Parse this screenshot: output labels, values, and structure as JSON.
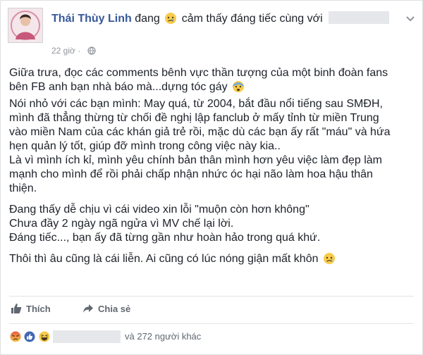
{
  "post": {
    "author": "Thái Thùy Linh",
    "status_prefix": "đang",
    "feeling": "cảm thấy đáng tiếc cùng với",
    "timestamp": "22 giờ",
    "paragraphs": [
      [
        "Giữa trưa, đọc các comments bênh vực thần tượng của một binh đoàn fans",
        "bên FB anh bạn nhà báo mà...dựng tóc gáy",
        "Nói nhỏ với các bạn mình: May quá, từ 2004, bắt đầu nổi tiếng sau SMĐH,",
        "mình đã thẳng thừng từ chối đề nghị lập fanclub ở mấy tỉnh từ miền Trung",
        "vào miền Nam của các khán giả trẻ rồi, mặc dù các bạn ấy rất \"máu\" và hứa",
        "hẹn quản lý tốt, giúp đỡ mình trong công việc này kia..",
        "Là vì mình ích kỉ, mình yêu chính bản thân mình hơn yêu việc làm đẹp làm",
        "mạnh cho mình để rồi phải chấp nhận nhức óc hại não làm hoa hậu thân",
        "thiện."
      ],
      [
        "Đang thấy dễ chịu vì cái video xin lỗi \"muộn còn hơn không\"",
        "Chưa đầy 2 ngày ngã ngửa vì MV chế lại lời.",
        "Đáng tiếc..., bạn ấy đã từng gần như hoàn hảo trong quá khứ."
      ],
      [
        "Thôi thì âu cũng là cái liễn. Ai cũng có lúc nóng giận mất khôn"
      ]
    ]
  },
  "actions": {
    "like_label": "Thích",
    "share_label": "Chia sẻ"
  },
  "reactions": {
    "icons": [
      "angry-icon",
      "like-icon",
      "haha-icon"
    ],
    "count_text": "và 272 người khác"
  },
  "icons": {
    "feeling": "sad-face-icon",
    "inline_1": "scared-face-icon",
    "inline_2": "sad-face-icon",
    "privacy": "globe-icon",
    "menu": "chevron-down-icon"
  },
  "colors": {
    "author": "#365899",
    "text": "#1d2129",
    "meta": "#90949c",
    "action": "#606770"
  }
}
